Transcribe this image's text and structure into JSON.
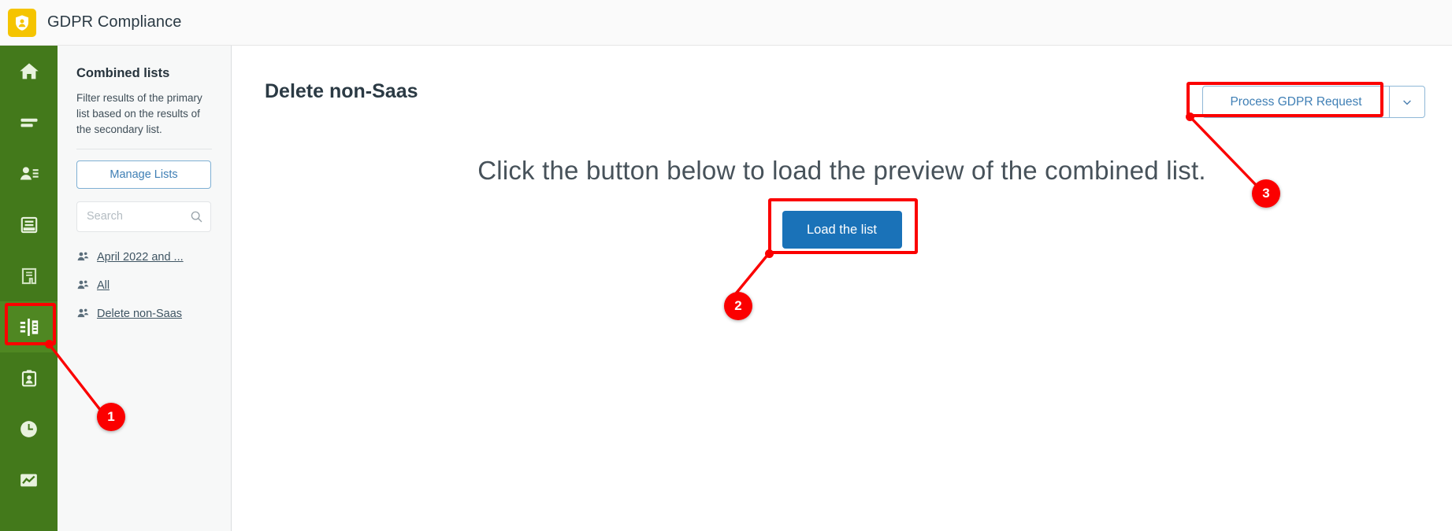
{
  "header": {
    "logo_icon": "shield-person-icon",
    "logo_color": "#f5c400",
    "title": "GDPR Compliance"
  },
  "rail": {
    "background_color": "#43791b",
    "active_color": "#4f8722",
    "items": [
      {
        "icon": "home-icon",
        "name": "home",
        "active": false
      },
      {
        "icon": "list-lines-icon",
        "name": "lists",
        "active": false
      },
      {
        "icon": "person-details-icon",
        "name": "contacts",
        "active": false
      },
      {
        "icon": "database-stack-icon",
        "name": "data-sources",
        "active": false
      },
      {
        "icon": "document-bookmark-icon",
        "name": "documents",
        "active": false
      },
      {
        "icon": "combined-lists-icon",
        "name": "combined-lists",
        "active": true
      },
      {
        "icon": "clipboard-person-icon",
        "name": "requests",
        "active": false
      },
      {
        "icon": "clock-icon",
        "name": "history",
        "active": false
      },
      {
        "icon": "chart-line-icon",
        "name": "reports",
        "active": false
      }
    ]
  },
  "sidebar": {
    "title": "Combined lists",
    "description": "Filter results of the primary list based on the results of the secondary list.",
    "manage_button": "Manage Lists",
    "search": {
      "value": "",
      "placeholder": "Search",
      "icon": "search-icon"
    },
    "items": [
      {
        "icon": "people-group-icon",
        "label": "April 2022 and ..."
      },
      {
        "icon": "people-group-icon",
        "label": "All"
      },
      {
        "icon": "people-group-icon",
        "label": "Delete non-Saas"
      }
    ]
  },
  "main": {
    "page_title": "Delete non-Saas",
    "primary_action": "Process GDPR Request",
    "caret_icon": "chevron-down-icon",
    "hero_text": "Click the button below to load the preview of the combined list.",
    "load_button": "Load the list",
    "load_button_color": "#1a72b8"
  },
  "annotations": {
    "color": "#fb0000",
    "badges": [
      {
        "number": "1",
        "target": "combined-lists-rail-icon"
      },
      {
        "number": "2",
        "target": "load-the-list-button"
      },
      {
        "number": "3",
        "target": "process-gdpr-request-button"
      }
    ]
  }
}
